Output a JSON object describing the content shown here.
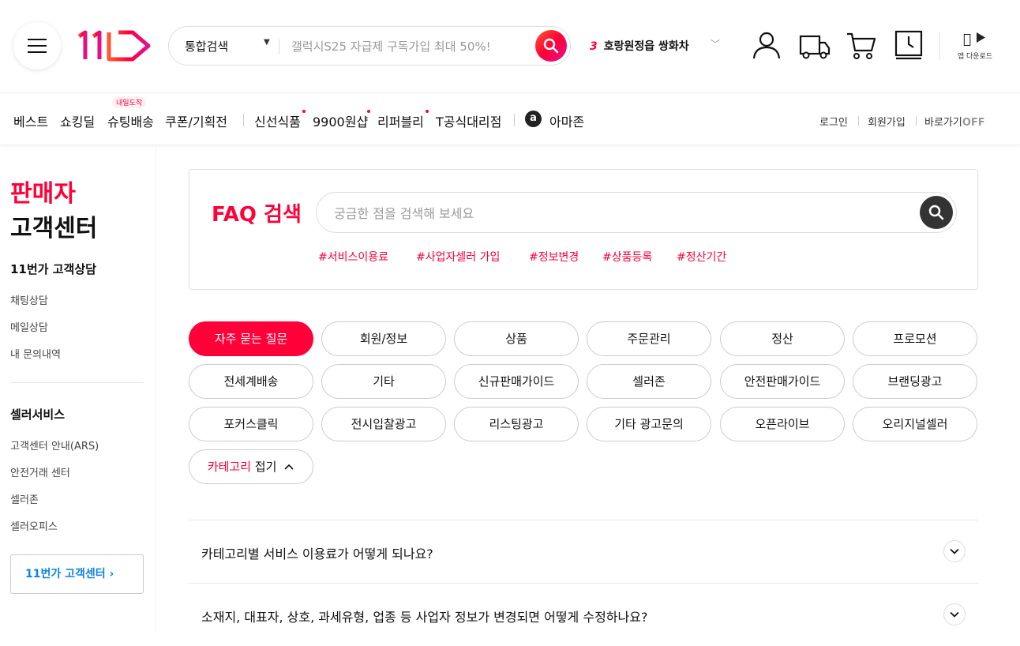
{
  "colors": {
    "brand": "#ff0038",
    "link": "#0b83e6",
    "text": "#111111"
  },
  "header": {
    "logo_text": "11번가",
    "search": {
      "category": "통합검색",
      "placeholder": "갤럭시S25 자급제 구독가입 최대 50%!"
    },
    "trending": {
      "rank": "3",
      "keyword": "호랑원정읍 쌍화차"
    },
    "app_download": "앱 다운로드",
    "icons": [
      "menu-icon",
      "search-icon",
      "user-icon",
      "truck-icon",
      "cart-icon",
      "recent-icon",
      "apple-icon",
      "google-play-icon"
    ]
  },
  "nav": {
    "items": [
      "베스트",
      "쇼킹딜",
      "슈팅배송",
      "쿠폰/기획전",
      "신선식품",
      "9900원샵",
      "리퍼블리",
      "T공식대리점",
      "아마존"
    ],
    "badge": "내일도착",
    "amazon_icon_letter": "a",
    "util": {
      "login": "로그인",
      "signup": "회원가입",
      "shortcut": "바로가기",
      "shortcut_state": "OFF"
    }
  },
  "sidebar": {
    "title_line1": "판매자",
    "title_line2": "고객센터",
    "section1": {
      "title": "11번가 고객상담",
      "links": [
        "채팅상담",
        "메일상담",
        "내 문의내역"
      ]
    },
    "section2": {
      "title": "셀러서비스",
      "links": [
        "고객센터 안내(ARS)",
        "안전거래 센터",
        "셀러존",
        "셀러오피스"
      ]
    },
    "cta": "11번가 고객센터 ›"
  },
  "faq": {
    "title": "FAQ 검색",
    "placeholder": "궁금한 점을 검색해 보세요",
    "tags": [
      "#서비스이용료",
      "#사업자셀러 가입",
      "#정보변경",
      "#상품등록",
      "#정산기간"
    ]
  },
  "categories": {
    "items": [
      "자주 묻는 질문",
      "회원/정보",
      "상품",
      "주문관리",
      "정산",
      "프로모션",
      "전세계배송",
      "기타",
      "신규판매가이드",
      "셀러존",
      "안전판매가이드",
      "브랜딩광고",
      "포커스클릭",
      "전시입찰광고",
      "리스팅광고",
      "기타 광고문의",
      "오픈라이브",
      "오리지널셀러"
    ],
    "active": "자주 묻는 질문",
    "fold_red": "카테고리",
    "fold_text": "접기"
  },
  "questions": [
    "카테고리별 서비스 이용료가 어떻게 되나요?",
    "소재지, 대표자, 상호, 과세유형, 업종 등 사업자 정보가 변경되면 어떻게 수정하나요?"
  ]
}
